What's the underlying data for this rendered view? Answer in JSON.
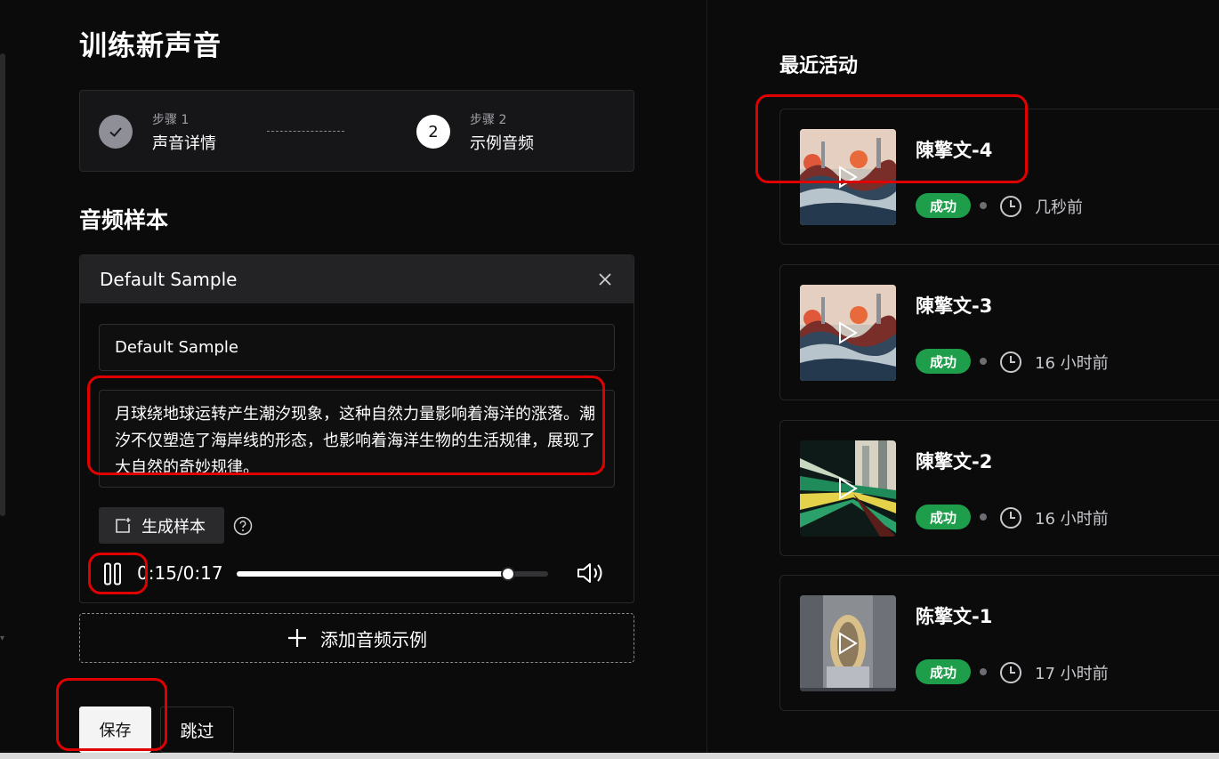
{
  "page": {
    "title": "训练新声音"
  },
  "stepper": {
    "step1": {
      "caption": "步骤 1",
      "name": "声音详情"
    },
    "step2": {
      "caption": "步骤 2",
      "name": "示例音频",
      "number": "2"
    }
  },
  "audio_section": {
    "title": "音频样本"
  },
  "sample": {
    "header_title": "Default Sample",
    "name_value": "Default Sample",
    "text": "月球绕地球运转产生潮汐现象，这种自然力量影响着海洋的涨落。潮汐不仅塑造了海岸线的形态，也影响着海洋生物的生活规律，展现了大自然的奇妙规律。",
    "generate_label": "生成样本",
    "player": {
      "time": "0:15/0:17",
      "progress": 0.87
    }
  },
  "add_example_label": "添加音频示例",
  "actions": {
    "save_label": "保存",
    "skip_label": "跳过"
  },
  "recent": {
    "title": "最近活动",
    "items": [
      {
        "name": "陳擎文-4",
        "status": "成功",
        "time": "几秒前",
        "thumb": "abstract-landscape"
      },
      {
        "name": "陳擎文-3",
        "status": "成功",
        "time": "16 小时前",
        "thumb": "abstract-landscape"
      },
      {
        "name": "陳擎文-2",
        "status": "成功",
        "time": "16 小时前",
        "thumb": "light-streaks"
      },
      {
        "name": "陈擎文-1",
        "status": "成功",
        "time": "17 小时前",
        "thumb": "architecture"
      }
    ]
  },
  "colors": {
    "success": "#1e9e4a",
    "annotation": "#e00000",
    "background": "#0b0b0c"
  }
}
